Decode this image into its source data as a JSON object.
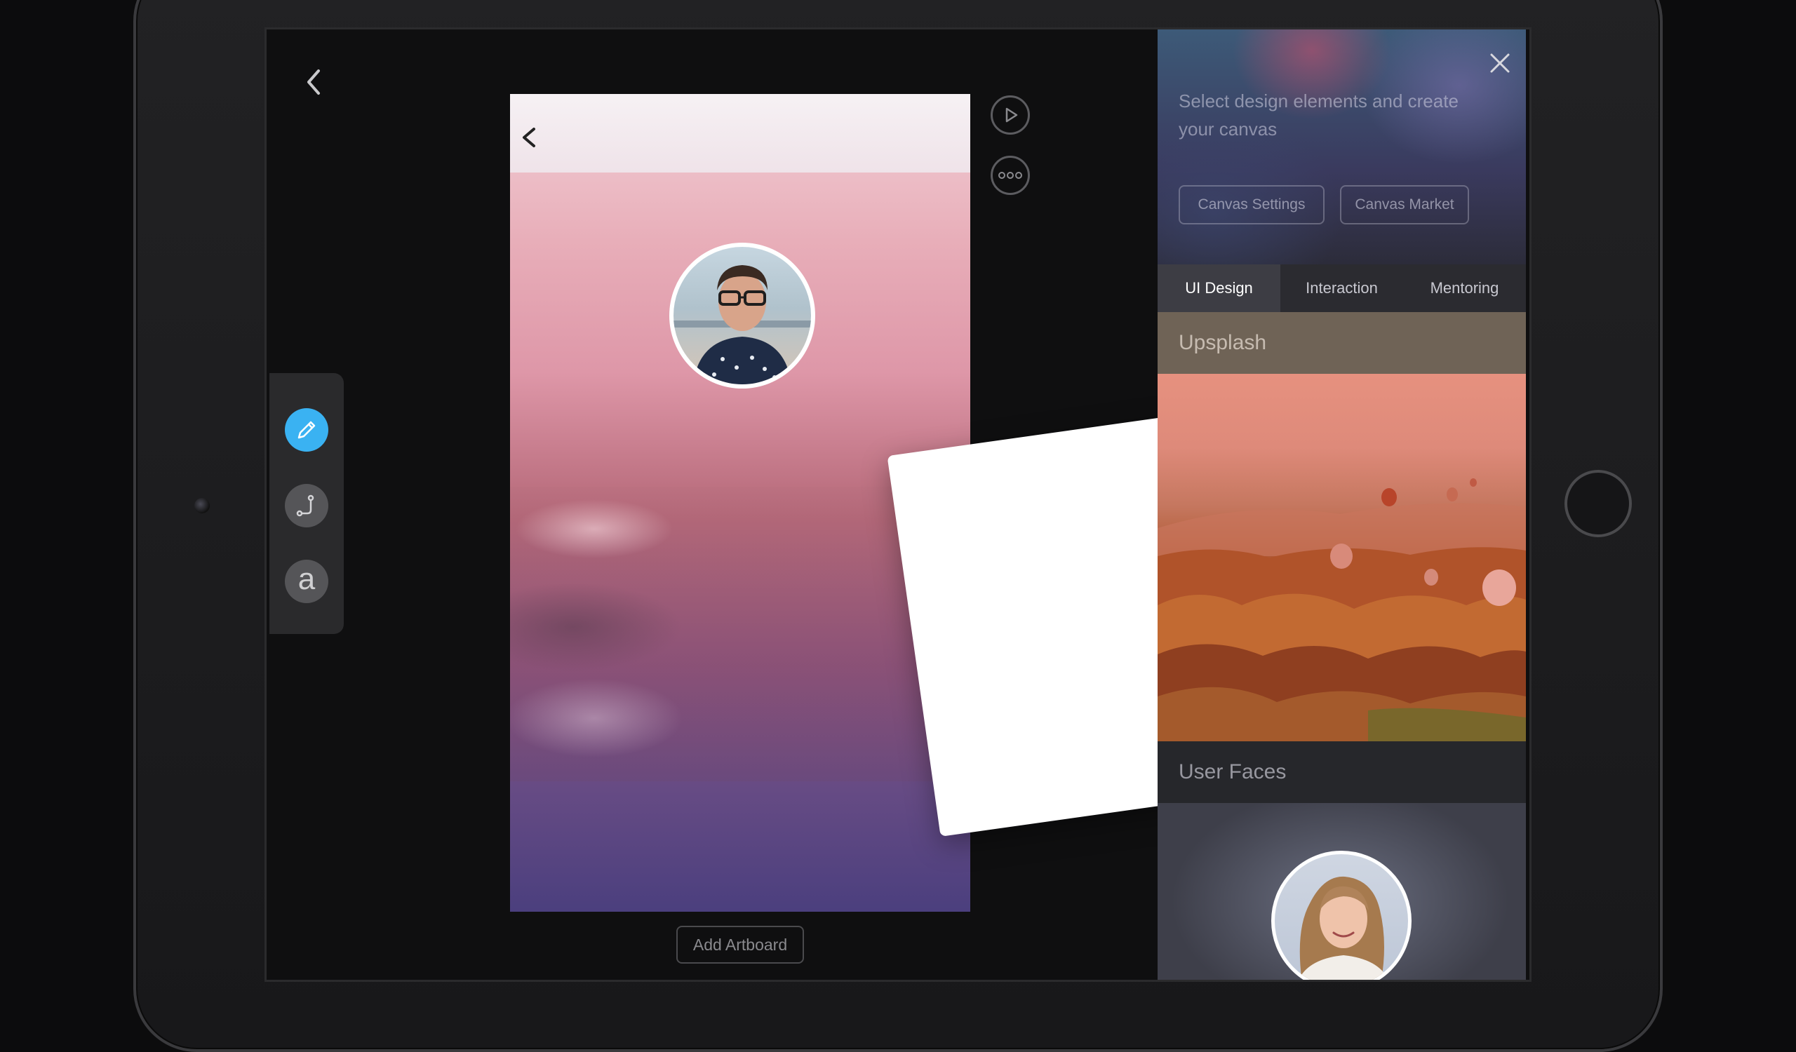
{
  "canvas": {
    "add_artboard_label": "Add Artboard"
  },
  "toolbar": {
    "tools": [
      {
        "icon": "pencil-icon",
        "active": true
      },
      {
        "icon": "connector-icon",
        "active": false
      },
      {
        "icon": "text-icon",
        "label": "a",
        "active": false
      }
    ]
  },
  "panel": {
    "intro": "Select design elements and create your canvas",
    "buttons": {
      "canvas_settings": "Canvas Settings",
      "canvas_market": "Canvas Market"
    },
    "tabs": [
      {
        "label": "UI Design",
        "active": true
      },
      {
        "label": "Interaction",
        "active": false
      },
      {
        "label": "Mentoring",
        "active": false
      }
    ],
    "sections": {
      "unsplash": "Upsplash",
      "user_faces": "User Faces"
    }
  },
  "colors": {
    "accent": "#3ab2f2",
    "screen_bg": "#0f0f10",
    "panel_tab_active": "#3d3d44"
  }
}
